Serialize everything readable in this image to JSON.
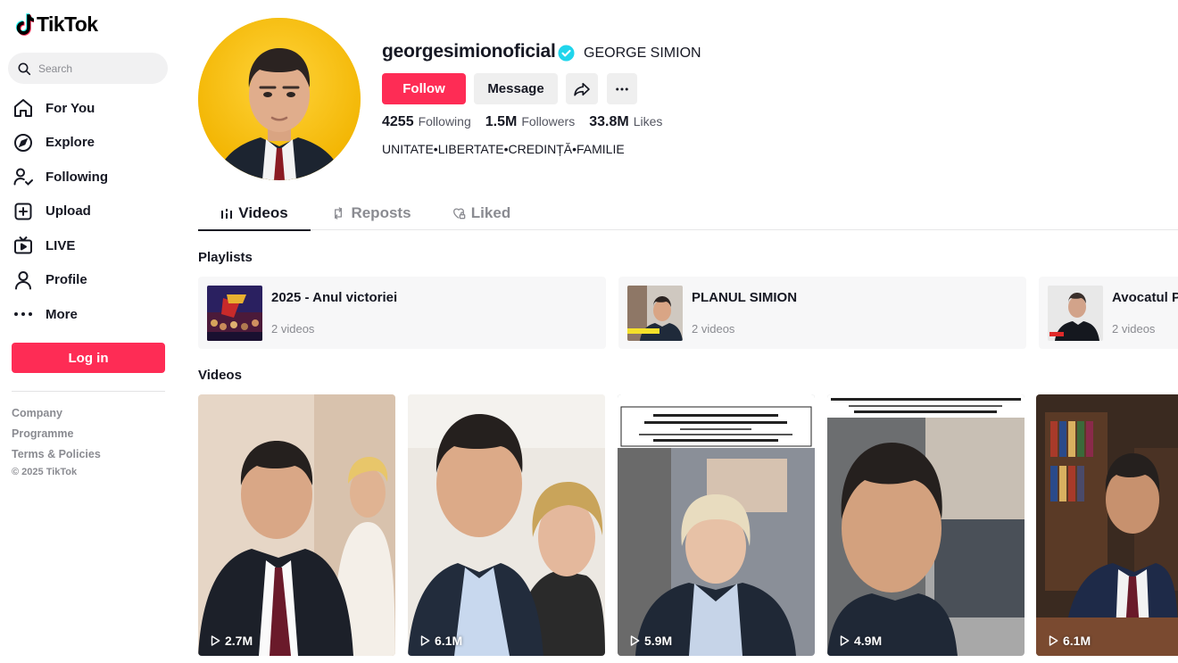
{
  "brand": {
    "name": "TikTok"
  },
  "search": {
    "placeholder": "Search"
  },
  "nav": {
    "items": [
      {
        "label": "For You",
        "icon": "home-icon"
      },
      {
        "label": "Explore",
        "icon": "compass-icon"
      },
      {
        "label": "Following",
        "icon": "following-user-icon"
      },
      {
        "label": "Upload",
        "icon": "upload-plus-icon"
      },
      {
        "label": "LIVE",
        "icon": "live-tv-icon"
      },
      {
        "label": "Profile",
        "icon": "profile-icon"
      },
      {
        "label": "More",
        "icon": "more-dots-icon"
      }
    ]
  },
  "login": {
    "label": "Log in"
  },
  "footer": {
    "links": [
      "Company",
      "Programme",
      "Terms & Policies"
    ],
    "copyright": "© 2025 TikTok"
  },
  "profile": {
    "username": "georgesimionoficial",
    "nickname": "GEORGE SIMION",
    "verified": true,
    "follow_label": "Follow",
    "message_label": "Message",
    "stats": [
      {
        "number": "4255",
        "label": "Following"
      },
      {
        "number": "1.5M",
        "label": "Followers"
      },
      {
        "number": "33.8M",
        "label": "Likes"
      }
    ],
    "bio": "UNITATE•LIBERTATE•CREDINȚĂ•FAMILIE"
  },
  "tabs": [
    {
      "label": "Videos",
      "active": true
    },
    {
      "label": "Reposts",
      "active": false
    },
    {
      "label": "Liked",
      "active": false
    }
  ],
  "playlists": {
    "heading": "Playlists",
    "items": [
      {
        "title": "2025 - Anul victoriei",
        "count": "2 videos"
      },
      {
        "title": "PLANUL SIMION",
        "count": "2 videos"
      },
      {
        "title": "Avocatul Po",
        "count": "2 videos"
      }
    ]
  },
  "videos": {
    "heading": "Videos",
    "items": [
      {
        "views": "2.7M"
      },
      {
        "views": "6.1M"
      },
      {
        "views": "5.9M"
      },
      {
        "views": "4.9M"
      },
      {
        "views": "6.1M"
      }
    ]
  },
  "colors": {
    "accent": "#fe2c55",
    "verified": "#20d5ec",
    "avatar_bg": "#f6c100"
  }
}
